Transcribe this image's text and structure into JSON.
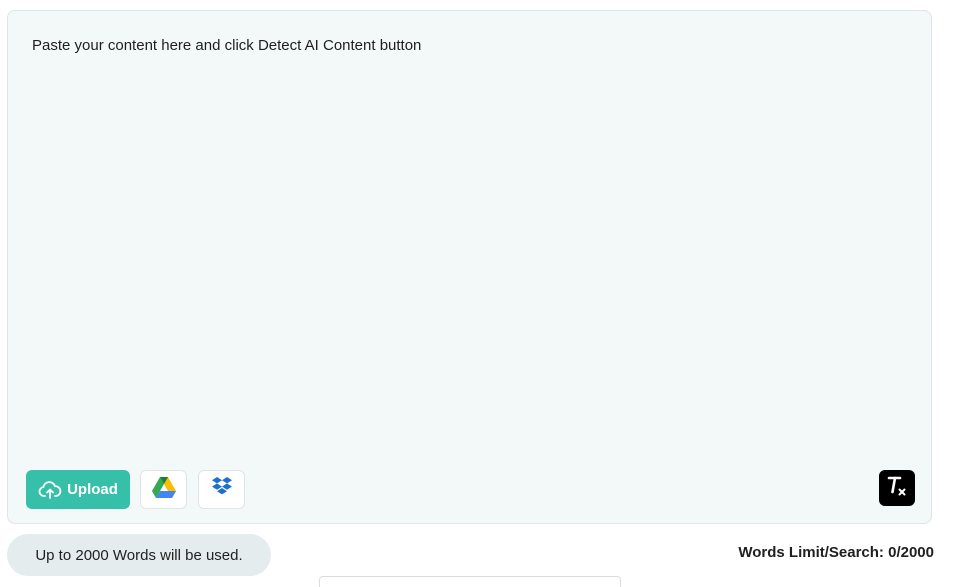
{
  "editor": {
    "placeholder": "Paste your content here and click Detect AI Content button",
    "value": ""
  },
  "toolbar": {
    "upload_label": "Upload",
    "upload_icon": "cloud-upload-icon",
    "google_drive_icon": "google-drive-icon",
    "dropbox_icon": "dropbox-icon",
    "clear_icon": "clear-format-icon"
  },
  "footer": {
    "note": "Up to 2000 Words will be used.",
    "words_limit_label": "Words Limit/Search:",
    "words_limit_value": "0/2000"
  },
  "colors": {
    "accent": "#36c0aa",
    "editor_bg": "#f3f8f8",
    "note_bg": "#e4eced"
  }
}
